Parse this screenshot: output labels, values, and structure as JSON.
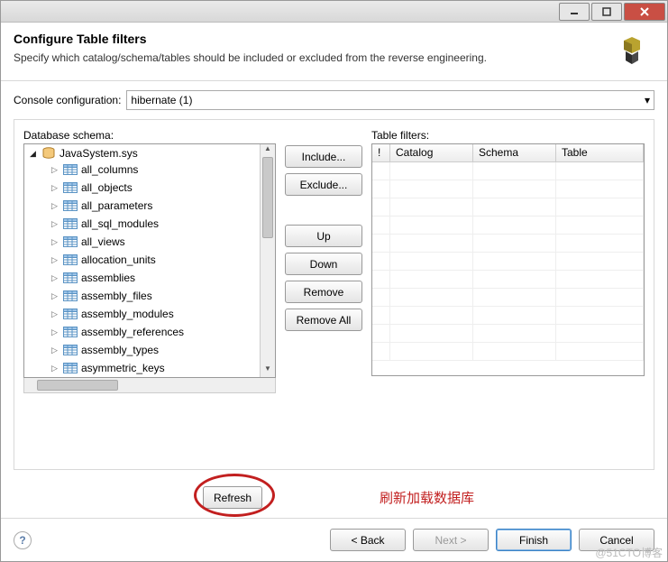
{
  "header": {
    "title": "Configure Table filters",
    "subtitle": "Specify which catalog/schema/tables should be included or excluded from the reverse engineering."
  },
  "config": {
    "label": "Console configuration:",
    "value": "hibernate (1)"
  },
  "schema": {
    "label": "Database schema:",
    "root": "JavaSystem.sys",
    "items": [
      "all_columns",
      "all_objects",
      "all_parameters",
      "all_sql_modules",
      "all_views",
      "allocation_units",
      "assemblies",
      "assembly_files",
      "assembly_modules",
      "assembly_references",
      "assembly_types",
      "asymmetric_keys"
    ]
  },
  "mid_buttons": {
    "include": "Include...",
    "exclude": "Exclude...",
    "up": "Up",
    "down": "Down",
    "remove": "Remove",
    "remove_all": "Remove All"
  },
  "filters": {
    "label": "Table filters:",
    "cols": {
      "bang": "!",
      "catalog": "Catalog",
      "schema": "Schema",
      "table": "Table"
    }
  },
  "refresh": {
    "label": "Refresh",
    "annotation": "刷新加载数据库"
  },
  "footer": {
    "back": "< Back",
    "next": "Next >",
    "finish": "Finish",
    "cancel": "Cancel"
  },
  "watermark": "@51CTO博客"
}
